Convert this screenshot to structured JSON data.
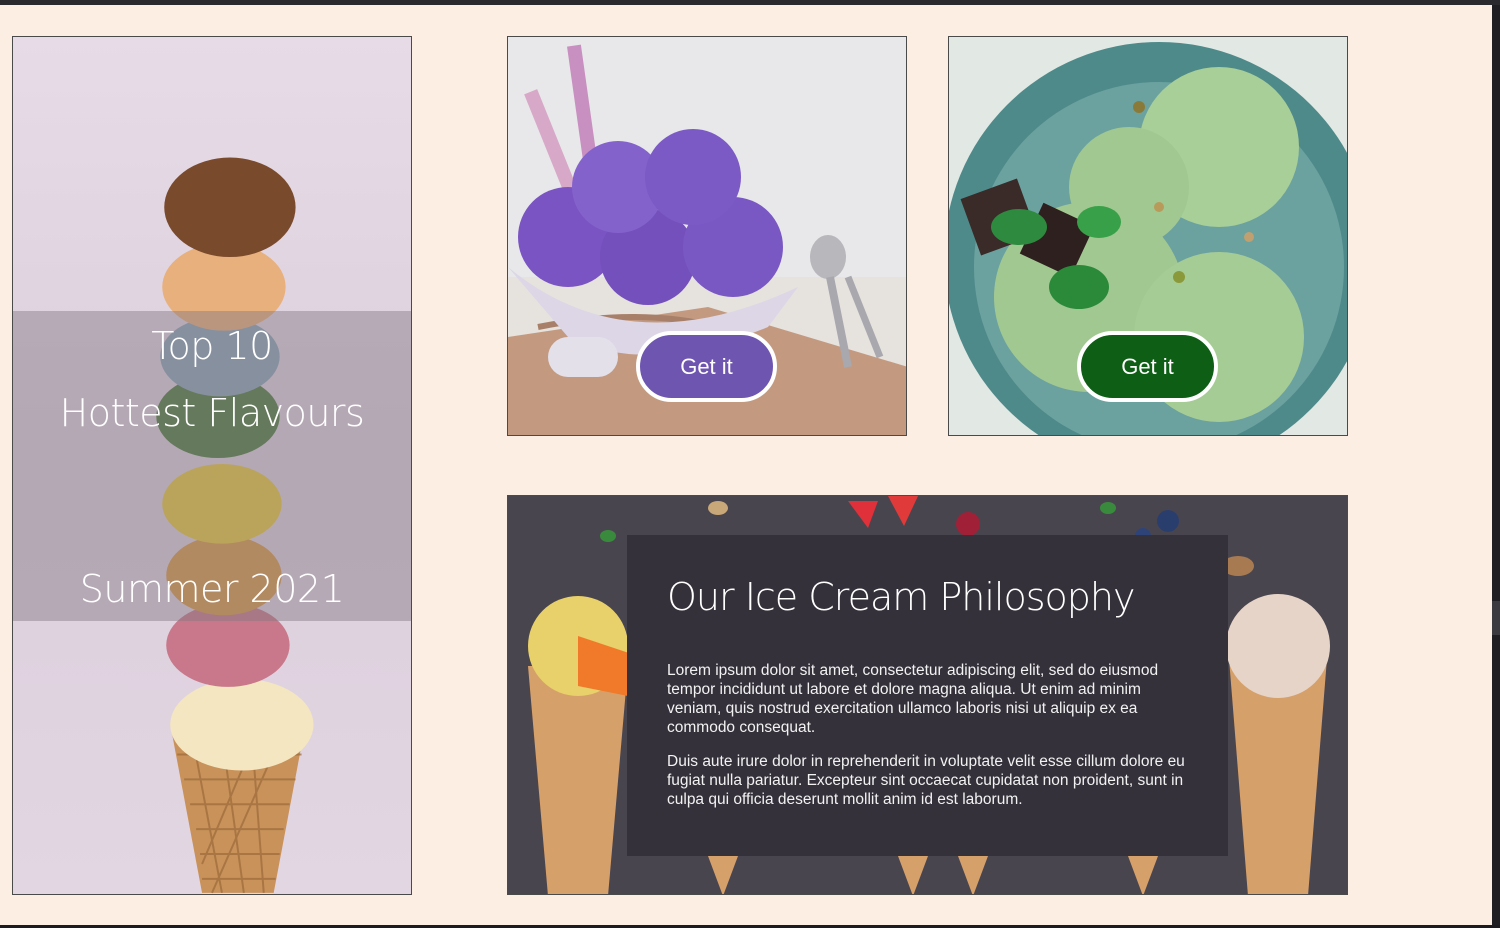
{
  "hero": {
    "line1": "Top 10",
    "line2": "Hottest Flavours",
    "line3": "Summer 2021"
  },
  "products": [
    {
      "button_label": "Get it",
      "color": "#6e55b0"
    },
    {
      "button_label": "Get it",
      "color": "#0e5e16"
    }
  ],
  "philosophy": {
    "title": "Our Ice Cream Philosophy",
    "paragraph1": "Lorem ipsum dolor sit amet, consectetur adipiscing elit, sed do eiusmod tempor incididunt ut labore et dolore magna aliqua. Ut enim ad minim veniam, quis nostrud exercitation ullamco laboris nisi ut aliquip ex ea commodo consequat.",
    "paragraph2": "Duis aute irure dolor in reprehenderit in voluptate velit esse cillum dolore eu fugiat nulla pariatur. Excepteur sint occaecat cupidatat non proident, sunt in culpa qui officia deserunt mollit anim id est laborum."
  },
  "colors": {
    "page_background": "#fdeee3",
    "overlay": "rgba(130,120,130,0.45)",
    "panel": "#35313a"
  }
}
